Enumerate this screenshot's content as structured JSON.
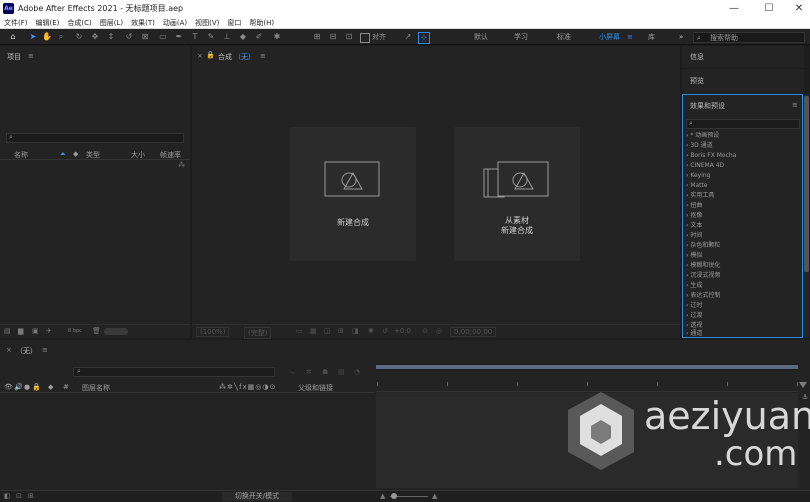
{
  "window": {
    "title": "Adobe After Effects 2021 - 无标题项目.aep",
    "app_icon": "Ae"
  },
  "window_controls": {
    "minimize": "—",
    "maximize": "☐",
    "close": "✕"
  },
  "menu": [
    "文件(F)",
    "编辑(E)",
    "合成(C)",
    "图层(L)",
    "效果(T)",
    "动画(A)",
    "视图(V)",
    "窗口",
    "帮助(H)"
  ],
  "toolbar": {
    "snap_label": "对齐",
    "workspaces": [
      "默认",
      "学习",
      "标准",
      "小屏幕",
      "库"
    ],
    "active_workspace": "小屏幕",
    "more": "»",
    "search_placeholder": "搜索帮助"
  },
  "project_panel": {
    "title": "项目",
    "menu_icon": "≡",
    "search_icon": "⌕",
    "columns": [
      "名称",
      "类型",
      "大小",
      "帧速率"
    ],
    "bpc": "8 bpc"
  },
  "comp_panel": {
    "title": "合成",
    "title_suffix": "（无）",
    "menu_icon": "≡",
    "new_comp_label": "新建合成",
    "from_footage_line1": "从素材",
    "from_footage_line2": "新建合成",
    "zoom": "(100%)",
    "quality": "(完整)",
    "exposure": "+0.0",
    "timecode": "0;00;00;00"
  },
  "right_panels": {
    "info": "信息",
    "preview": "预览",
    "effects_title": "效果和预设",
    "effects_menu": "≡",
    "effects": [
      "* 动画预设",
      "3D 通道",
      "Boris FX Mocha",
      "CINEMA 4D",
      "Keying",
      "Matte",
      "实用工具",
      "扭曲",
      "抠像",
      "文本",
      "时间",
      "杂色和颗粒",
      "模拟",
      "模糊和锐化",
      "沉浸式视频",
      "生成",
      "表达式控制",
      "过时",
      "过渡",
      "透视",
      "通道"
    ]
  },
  "timeline": {
    "tab_label": "（无）",
    "menu_icon": "≡",
    "layer_name_col": "图层名称",
    "parent_col": "父级和链接",
    "switch_toggle": "切换开关/模式"
  },
  "watermark": {
    "text1": "aeziyuan",
    "text2": ".com"
  }
}
